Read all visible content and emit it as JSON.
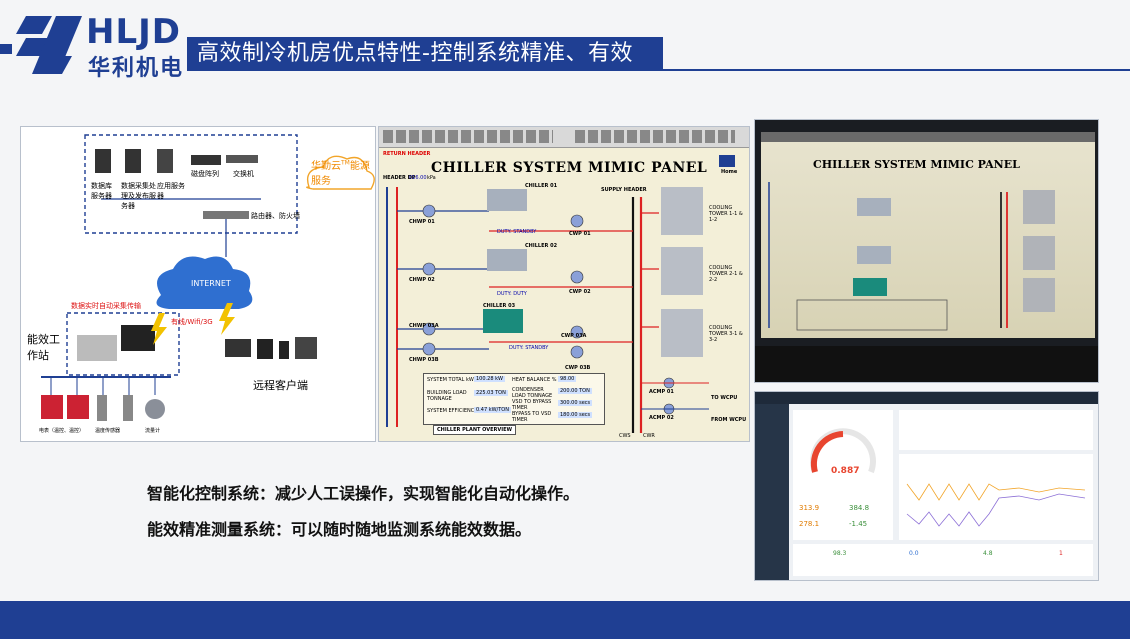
{
  "brand": {
    "name_en": "HLJD",
    "name_cn": "华利机电",
    "primary_color": "#1f3f93"
  },
  "slide": {
    "title": "高效制冷机房优点特性-控制系统精准、有效"
  },
  "network_diagram": {
    "servers": [
      "数据库服务器",
      "数据采集处理及发布服务器",
      "应用服务器",
      "磁盘阵列",
      "交换机"
    ],
    "firewall": "路由器、防火墙",
    "cloud_label": "华勤云",
    "cloud_tm": "TM",
    "cloud_sub": "能源服务",
    "internet": "INTERNET",
    "realtime": "数据实时自动采集传输",
    "wireless": "有线/Wifi/3G",
    "station": "能效工作站",
    "remote": "远程客户端",
    "sensors": [
      "电表（温控、温控）",
      "温度传感器",
      "流量计"
    ]
  },
  "mimic_panel": {
    "title": "CHILLER SYSTEM MIMIC PANEL",
    "home": "Home",
    "return_header": "RETURN HEADER",
    "header_dp": "HEADER DP",
    "header_dp_value": "016.00",
    "unit_kpa": "kPa",
    "chillers": [
      "CHILLER 01",
      "CHILLER 02",
      "CHILLER 03"
    ],
    "supply_header": "SUPPLY HEADER",
    "chwp": [
      "CHWP 01",
      "CHWP 02",
      "CHWP 03A",
      "CHWP 03B"
    ],
    "cwp": [
      "CWP 01",
      "CWP 02",
      "CWP 03A",
      "CWP 03B"
    ],
    "duty": [
      "DUTY: STANDBY",
      "DUTY: DUTY",
      "DUTY: STANDBY"
    ],
    "towers": [
      "COOLING TOWER 1-1 & 1-2",
      "COOLING TOWER 2-1 & 2-2",
      "COOLING TOWER 3-1 & 3-2"
    ],
    "acmp": [
      "ACMP 01",
      "ACMP 02"
    ],
    "to_wcpu": "TO WCPU",
    "from_wcpu": "FROM WCPU",
    "stats": [
      {
        "label": "SYSTEM TOTAL kW",
        "value": "100.28 kW"
      },
      {
        "label": "BUILDING LOAD TONNAGE",
        "value": "225.03 TON"
      },
      {
        "label": "SYSTEM EFFICIENCY",
        "value": "0.47 kW/TON"
      },
      {
        "label": "HEAT BALANCE %",
        "value": "98.00"
      },
      {
        "label": "CONDENSER LOAD TONNAGE",
        "value": "200.00 TON"
      },
      {
        "label": "VSD TO BYPASS TIMER",
        "value": "300.00 secs"
      },
      {
        "label": "BYPASS TO VSD TIMER",
        "value": "180.00 secs"
      }
    ],
    "overview": "CHILLER PLANT OVERVIEW",
    "cws": "CWS",
    "cwr": "CWR",
    "on": "ON",
    "off": "OFF"
  },
  "photo": {
    "title": "CHILLER SYSTEM MIMIC PANEL"
  },
  "dashboard": {
    "gauge_value": "0.887",
    "left_values": [
      "313.9",
      "384.8",
      "278.1",
      "-1.45"
    ],
    "bottom_values": [
      "98.3",
      "0.0",
      "4.8",
      "1"
    ]
  },
  "bullets": [
    "智能化控制系统：减少人工误操作，实现智能化自动化操作。",
    "能效精准测量系统：可以随时随地监测系统能效数据。"
  ]
}
